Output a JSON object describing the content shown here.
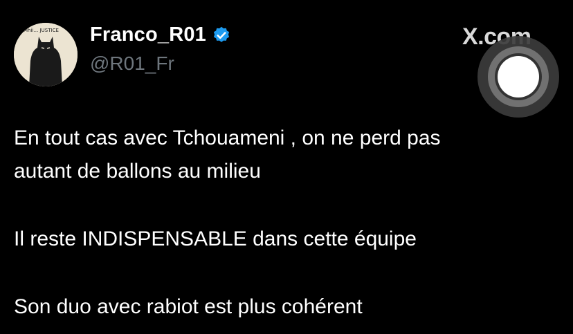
{
  "author": {
    "display_name": "Franco_R01",
    "handle": "@R01_Fr",
    "verified": true,
    "avatar_text": "Mhii… JUSTICE",
    "verified_color": "#1d9bf0"
  },
  "brand": {
    "label": "X.com",
    "icon": "x-logo-icon"
  },
  "tweet": {
    "lines": [
      "En tout cas avec Tchouameni , on ne perd pas",
      "autant de ballons au milieu",
      "Il reste INDISPENSABLE dans cette équipe",
      "Son duo avec rabiot est plus cohérent"
    ]
  },
  "overlay": {
    "icon": "assistive-touch-icon"
  }
}
